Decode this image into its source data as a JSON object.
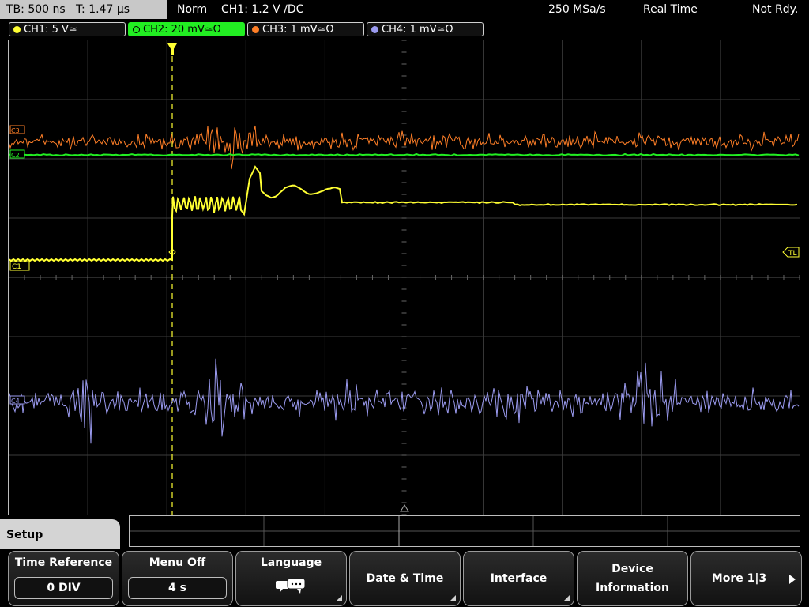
{
  "top": {
    "timebase": "TB: 500 ns   T: 1.47 µs",
    "mode": "Norm",
    "trigger": "CH1: 1.2 V ∕DC",
    "sample_rate": "250 MSa/s",
    "acq_mode": "Real Time",
    "status": "Not Rdy."
  },
  "channels": [
    {
      "label": "CH1: 5 V≃",
      "color": "#ffff33"
    },
    {
      "label": "CH2: 20 mV≃Ω",
      "color": "#22ee22"
    },
    {
      "label": "CH3: 1 mV≃Ω",
      "color": "#ff7f27"
    },
    {
      "label": "CH4: 1 mV≃Ω",
      "color": "#9b9bf0"
    }
  ],
  "markers": {
    "trigger_level": "TL",
    "ch1": "C1",
    "ch2": "C2",
    "ch3": "C3",
    "ch4": "C4"
  },
  "colors": {
    "ch1": "#ffff33",
    "ch2": "#22ee22",
    "ch3": "#ff7f27",
    "ch4": "#9b9bf0",
    "grid": "#3c3c3c"
  },
  "menu": {
    "title": "Setup",
    "softkeys": [
      {
        "label": "Time Reference",
        "value": "0 DIV"
      },
      {
        "label": "Menu Off",
        "value": "4 s"
      },
      {
        "label": "Language",
        "icon": "speech-bubbles-icon"
      },
      {
        "label": "Date & Time"
      },
      {
        "label": "Interface"
      },
      {
        "label_line1": "Device",
        "label_line2": "Information"
      },
      {
        "label": "More 1|3",
        "icon": "right-arrow-icon"
      }
    ]
  }
}
